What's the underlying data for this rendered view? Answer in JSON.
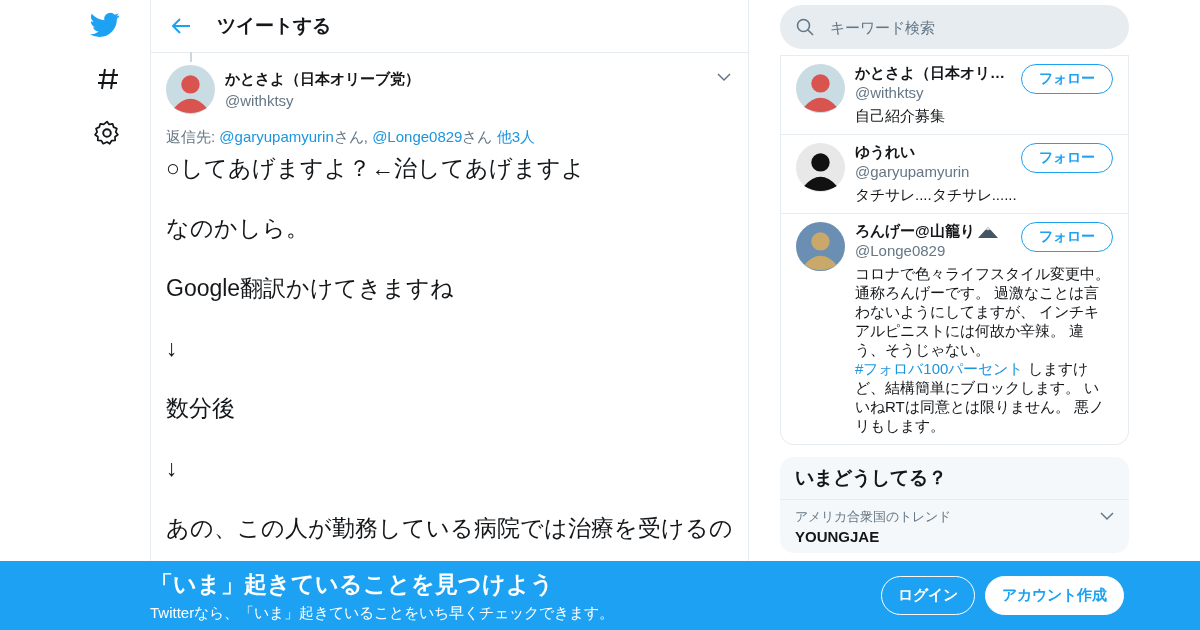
{
  "header": {
    "title": "ツイートする"
  },
  "tweet": {
    "name": "かとさよ（日本オリーブ党）",
    "handle": "@withktsy",
    "reply_to": [
      {
        "kind": "text",
        "text": "返信先: "
      },
      {
        "kind": "link",
        "text": "@garyupamyurin"
      },
      {
        "kind": "text",
        "text": "さん, "
      },
      {
        "kind": "link",
        "text": "@Longe0829"
      },
      {
        "kind": "text",
        "text": "さん "
      },
      {
        "kind": "link",
        "text": "他3人"
      }
    ],
    "paragraphs": [
      "○してあげますよ？←治してあげますよ",
      "なのかしら。",
      "Google翻訳かけてきますね",
      "↓",
      "数分後",
      "↓",
      "あの、この人が勤務している病院では治療を受けるの"
    ]
  },
  "search": {
    "placeholder": "キーワード検索"
  },
  "follow_list": [
    {
      "name": "かとさよ（日本オリ…",
      "handle": "@withktsy",
      "button": "フォロー",
      "bio": [
        {
          "kind": "text",
          "text": "自己紹介募集"
        }
      ]
    },
    {
      "name": "ゆうれい",
      "handle": "@garyupamyurin",
      "button": "フォロー",
      "bio": [
        {
          "kind": "text",
          "text": "タチサレ....タチサレ......"
        }
      ]
    },
    {
      "name": "ろんげー@山籠り",
      "name_badge": true,
      "handle": "@Longe0829",
      "button": "フォロー",
      "bio": [
        {
          "kind": "text",
          "text": "コロナで色々ライフスタイル変更中。通称ろんげーです。 過激なことは言わないようにしてますが、 インチキアルピニストには何故か辛辣。 違う、そうじゃない。 "
        },
        {
          "kind": "link",
          "text": "#フォロバ100パーセント"
        },
        {
          "kind": "text",
          "text": " しますけど、結構簡単にブロックします。 いいねRTは同意とは限りません。 悪ノリもします。"
        }
      ]
    }
  ],
  "trends": {
    "title": "いまどうしてる？",
    "items": [
      {
        "context": "アメリカ合衆国のトレンド",
        "name": "YOUNGJAE"
      }
    ]
  },
  "banner": {
    "title": "「いま」起きていることを見つけよう",
    "subtitle": "Twitterなら、「いま」起きていることをいち早くチェックできます。",
    "login": "ログイン",
    "signup": "アカウント作成"
  }
}
